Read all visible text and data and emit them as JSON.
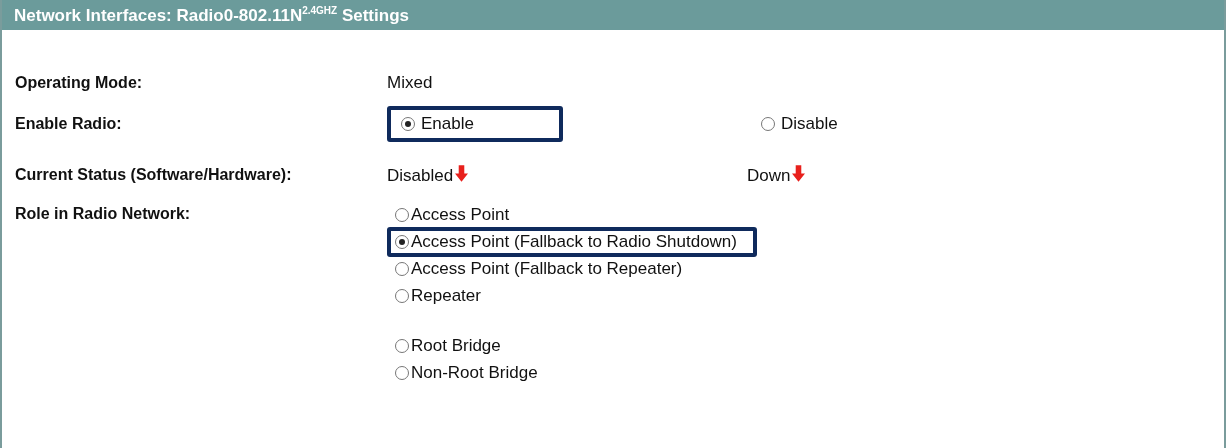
{
  "panel": {
    "title": "Network Interfaces: Radio0-802.11N$^{2.4GHZ}$ Settings"
  },
  "rows": [
    {
      "kind": "text",
      "label": "Operating Mode:",
      "values": [
        {
          "text": "Mixed"
        }
      ]
    },
    {
      "kind": "radio",
      "label": "Enable Radio:",
      "options": [
        {
          "label": "Enable",
          "selected": true,
          "highlighted": true
        },
        {
          "label": "Disable",
          "selected": false,
          "highlighted": false
        }
      ]
    },
    {
      "kind": "status",
      "label": "Current Status (Software/Hardware):",
      "values": [
        {
          "text": "Disabled",
          "down_arrow": true
        },
        {
          "text": "Down",
          "down_arrow": true
        }
      ]
    },
    {
      "kind": "radiolist",
      "label": "Role in Radio Network:",
      "groups": [
        [
          {
            "label": "Access Point",
            "selected": false,
            "highlighted": false
          },
          {
            "label": "Access Point (Fallback to Radio Shutdown)",
            "selected": true,
            "highlighted": true
          },
          {
            "label": "Access Point (Fallback to Repeater)",
            "selected": false,
            "highlighted": false
          },
          {
            "label": "Repeater",
            "selected": false,
            "highlighted": false
          }
        ],
        [
          {
            "label": "Root Bridge",
            "selected": false,
            "highlighted": false
          },
          {
            "label": "Non-Root Bridge",
            "selected": false,
            "highlighted": false
          }
        ]
      ]
    }
  ]
}
